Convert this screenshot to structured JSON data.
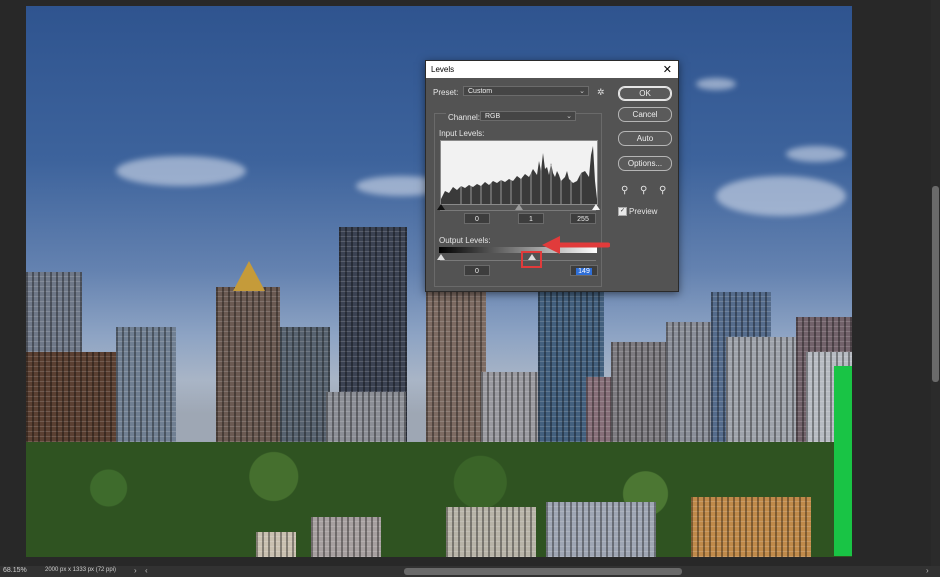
{
  "dialog": {
    "title": "Levels",
    "preset_label": "Preset:",
    "preset_value": "Custom",
    "channel_label": "Channel:",
    "channel_value": "RGB",
    "input_levels_label": "Input Levels:",
    "input_values": [
      "0",
      "1",
      "255"
    ],
    "output_levels_label": "Output Levels:",
    "output_values": [
      "0",
      "149"
    ],
    "buttons": {
      "ok": "OK",
      "cancel": "Cancel",
      "auto": "Auto",
      "options": "Options..."
    },
    "preview_label": "Preview",
    "preview_checked": true
  },
  "statusbar": {
    "zoom": "68.15%",
    "doc_info": "2000 px x 1333 px (72 ppi)"
  },
  "colors": {
    "annotation": "#e13b3b",
    "selection": "#2f6fd8"
  }
}
